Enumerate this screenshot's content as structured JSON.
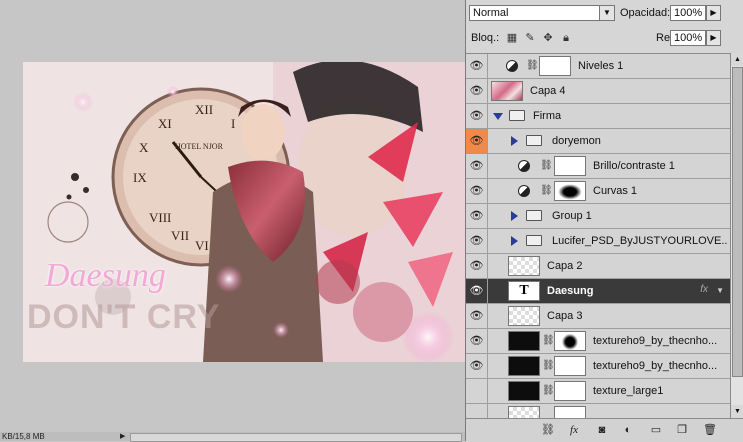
{
  "layers_panel": {
    "blend_mode": "Normal",
    "opacity_label": "Opacidad:",
    "opacity_value": "100%",
    "lock_label": "Bloq.:",
    "fill_label": "Relleno:",
    "fill_value": "100%",
    "layers": [
      {
        "name": "Niveles 1",
        "kind": "adjustment",
        "icon": "levels-icon"
      },
      {
        "name": "Capa 4",
        "kind": "photo"
      },
      {
        "name": "Firma",
        "kind": "group-open"
      },
      {
        "name": "doryemon",
        "kind": "group-closed"
      },
      {
        "name": "Brillo/contraste 1",
        "kind": "adjustment",
        "icon": "brightness-icon"
      },
      {
        "name": "Curvas 1",
        "kind": "adjustment",
        "icon": "curves-icon"
      },
      {
        "name": "Group 1",
        "kind": "group-closed"
      },
      {
        "name": "Lucifer_PSD_ByJUSTYOURLOVE....",
        "kind": "group-closed"
      },
      {
        "name": "Capa 2",
        "kind": "pixel"
      },
      {
        "name": "Daesung",
        "kind": "type",
        "selected": true,
        "glyph": "T"
      },
      {
        "name": "Capa 3",
        "kind": "pixel"
      },
      {
        "name": "textureho9_by_thecnho...",
        "kind": "texture"
      },
      {
        "name": "textureho9_by_thecnho...",
        "kind": "texture"
      },
      {
        "name": "texture_large1",
        "kind": "texture"
      }
    ],
    "fx_label": "fx"
  },
  "artwork": {
    "script_title": "Daesung",
    "big_text": "DON'T CRY",
    "clock_text": "HOTEL NJOR"
  },
  "status_bar": {
    "text": "KB/15,8 MB"
  },
  "colors": {
    "accent_orange": "#f08a4b",
    "selected_row": "#3a3a3a",
    "panel_bg": "#d6d6d6"
  }
}
